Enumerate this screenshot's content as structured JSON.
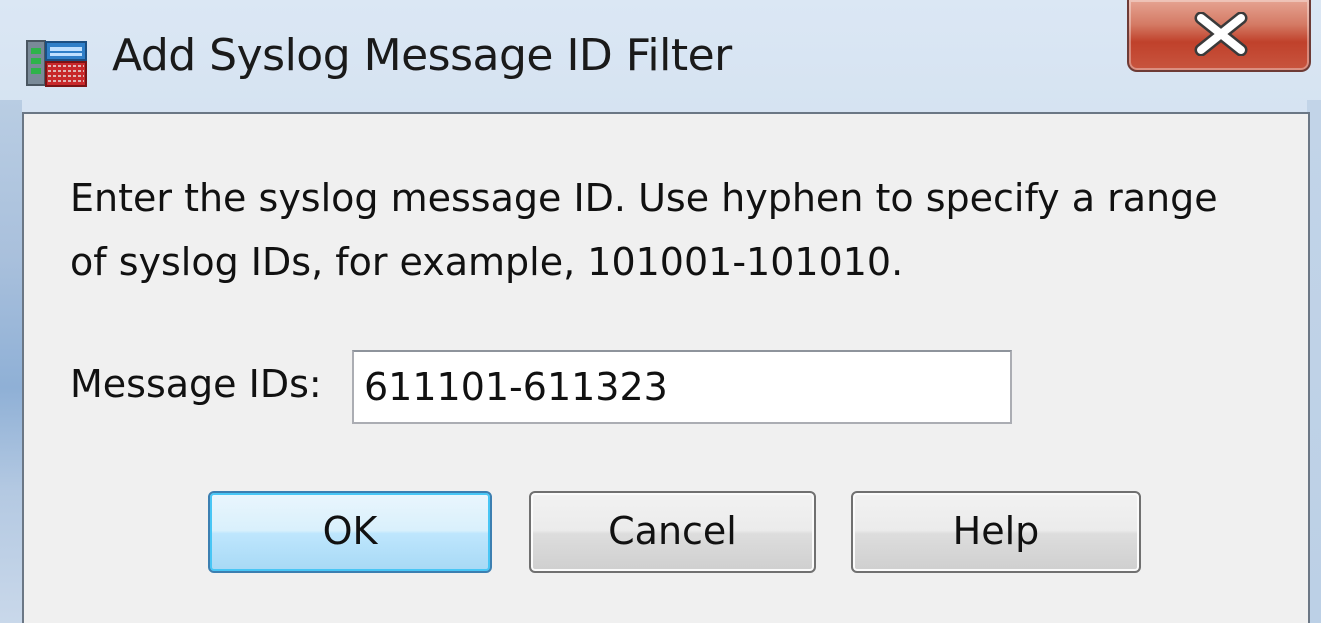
{
  "window": {
    "title": "Add Syslog Message ID Filter"
  },
  "dialog": {
    "instruction_line1": "Enter the syslog message ID. Use hyphen to specify a range",
    "instruction_line2": "of syslog IDs, for example, 101001-101010.",
    "message_ids_label": "Message IDs:",
    "message_ids_value": "611101-611323"
  },
  "buttons": {
    "ok": "OK",
    "cancel": "Cancel",
    "help": "Help"
  },
  "icons": {
    "app": "syslog-filter-icon",
    "close": "close-icon"
  },
  "colors": {
    "close_button": "#c8553f",
    "ok_button_border": "#3c7fb1",
    "client_background": "#f0f0f0"
  }
}
